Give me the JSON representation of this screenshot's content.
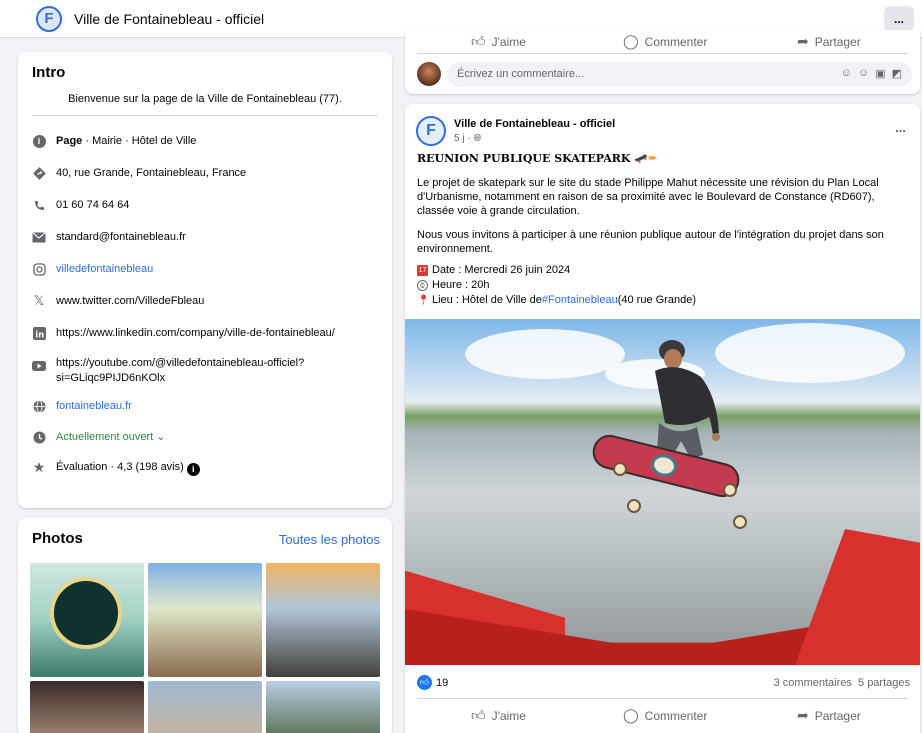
{
  "header": {
    "page_name": "Ville de Fontainebleau - officiel",
    "more_label": "...",
    "logo_letter": "F"
  },
  "intro": {
    "title": "Intro",
    "bio": "Bienvenue sur la page de la Ville de Fontainebleau (77).",
    "items": [
      {
        "icon": "info-icon",
        "strong": "Page",
        "text": " · Mairie · Hôtel de Ville"
      },
      {
        "icon": "location-icon",
        "text": "40, rue Grande, Fontainebleau, France"
      },
      {
        "icon": "phone-icon",
        "text": "01 60 74 64 64"
      },
      {
        "icon": "email-icon",
        "text": "standard@fontainebleau.fr"
      },
      {
        "icon": "instagram-icon",
        "text": "villedefontainebleau"
      },
      {
        "icon": "x-twitter-icon",
        "text": "www.twitter.com/VilledeFbleau"
      },
      {
        "icon": "linkedin-icon",
        "text": "https://www.linkedin.com/company/ville-de-fontainebleau/"
      },
      {
        "icon": "youtube-icon",
        "text": "https://youtube.com/@villedefontainebleau-officiel?",
        "text2": "si=GLiqc9PIJD6nKOlx"
      },
      {
        "icon": "globe-icon",
        "text": "fontainebleau.fr"
      },
      {
        "icon": "clock-icon",
        "text": "Actuellement ouvert",
        "chevron": "⌄"
      },
      {
        "icon": "star-icon",
        "text": "Évaluation · 4,3 (198 avis)"
      }
    ]
  },
  "photos": {
    "title": "Photos",
    "all_link": "Toutes les photos"
  },
  "prev_post": {
    "like_label": "J'aime",
    "comment_label": "Commenter",
    "share_label": "Partager",
    "comment_placeholder": "Écrivez un commentaire..."
  },
  "post": {
    "author": "Ville de Fontainebleau - officiel",
    "time": "5 j · ",
    "more_label": "...",
    "title": "REUNION PUBLIQUE SKATEPARK",
    "title_emoji": "🛹✒",
    "paragraph1": "Le projet de skatepark sur le site du stade Philippe Mahut nécessite une révision du Plan Local d'Urbanisme, notamment en raison de sa proximité avec le Boulevard de Constance (RD607), classée voie à grande circulation.",
    "paragraph2": "Nous vous invitons à participer à une réunion publique autour de l'intégration du projet dans son environnement.",
    "date_line": "Date : Mercredi 26 juin 2024",
    "time_line": "Heure : 20h",
    "place_prefix": "Lieu : Hôtel de Ville de ",
    "place_hashtag": "#Fontainebleau",
    "place_suffix": " (40 rue Grande)",
    "likes_count": "19",
    "comments_count": "3 commentaires",
    "shares_count": "5 partages",
    "like_label": "J'aime",
    "comment_label": "Commenter",
    "share_label": "Partager"
  }
}
